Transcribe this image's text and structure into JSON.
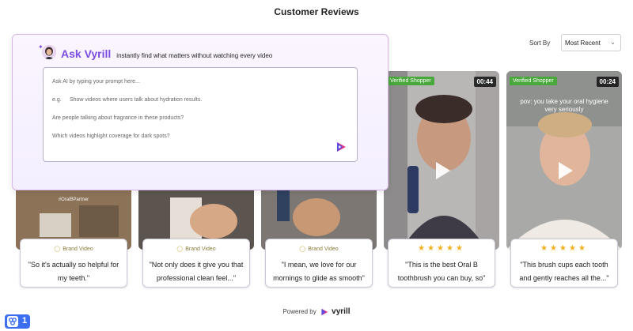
{
  "header": {
    "title": "Customer Reviews"
  },
  "sort": {
    "label": "Sort By",
    "selected": "Most Recent"
  },
  "ask_panel": {
    "title": "Ask Vyrill",
    "subtitle": "instantly find what matters without watching every video",
    "placeholder": "Ask AI by typing your prompt here...",
    "example_prefix": "e.g.",
    "examples": [
      "Show videos where users talk about hydration results.",
      "Are people talking about fragrance in these products?",
      "Which videos highlight coverage for dark spots?"
    ]
  },
  "reviews": [
    {
      "kind": "brand",
      "tag": "Brand Video",
      "quote": "\"So it's actually so helpful for my teeth.\"",
      "watermark": "#OralBPartner"
    },
    {
      "kind": "brand",
      "tag": "Brand Video",
      "quote": "\"Not only does it give you that professional clean feel...\""
    },
    {
      "kind": "brand",
      "tag": "Brand Video",
      "quote": "\"I mean, we love for our mornings to glide as smooth\""
    },
    {
      "kind": "verified",
      "badge": "Verified Shopper",
      "duration": "00:44",
      "rating": "★★★★★",
      "quote": "\"This is the best Oral B toothbrush you can buy, so\""
    },
    {
      "kind": "verified",
      "badge": "Verified Shopper",
      "duration": "00:24",
      "rating": "★★★★★",
      "overlay": "pov: you take your oral hygiene very seriously",
      "quote": "\"This brush cups each tooth and gently reaches all the...\""
    }
  ],
  "footer": {
    "powered_by": "Powered by",
    "brand": "vyrill"
  },
  "widget": {
    "count": "1"
  },
  "colors": {
    "accent": "#7b4de0",
    "verified": "#48a83b",
    "star": "#f2b01e",
    "corner": "#3c6ff0"
  }
}
